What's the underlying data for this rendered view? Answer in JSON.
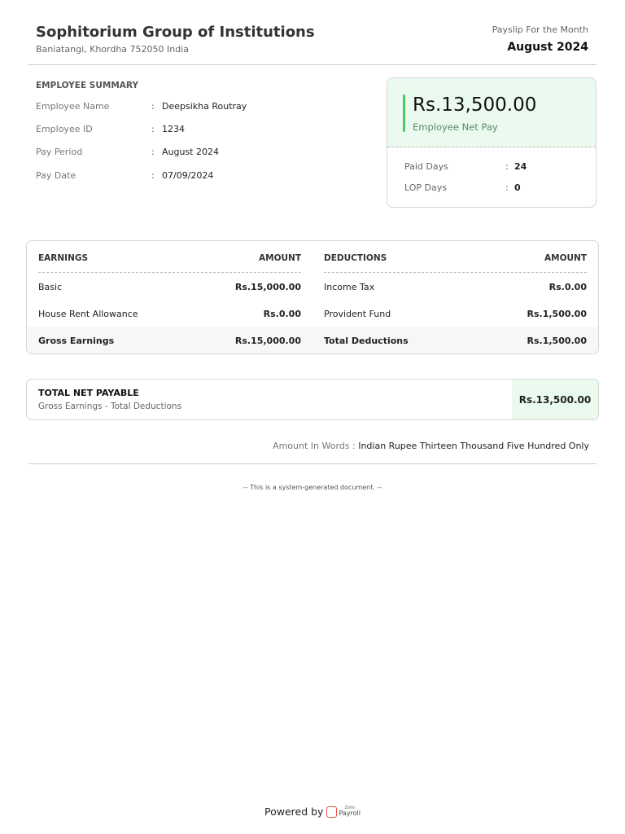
{
  "header": {
    "org_name": "Sophitorium Group of Institutions",
    "address": "Baniatangi, Khordha 752050 India",
    "payslip_label": "Payslip For the Month",
    "month": "August 2024"
  },
  "summary": {
    "title": "EMPLOYEE SUMMARY",
    "rows": [
      {
        "label": "Employee Name",
        "value": "Deepsikha Routray"
      },
      {
        "label": "Employee ID",
        "value": "1234"
      },
      {
        "label": "Pay Period",
        "value": "August 2024"
      },
      {
        "label": "Pay Date",
        "value": "07/09/2024"
      }
    ]
  },
  "net_card": {
    "amount": "Rs.13,500.00",
    "label": "Employee Net Pay",
    "rows": [
      {
        "label": "Paid Days",
        "value": "24"
      },
      {
        "label": "LOP Days",
        "value": "0"
      }
    ]
  },
  "earnings": {
    "header": "EARNINGS",
    "amount_header": "AMOUNT",
    "rows": [
      {
        "label": "Basic",
        "value": "Rs.15,000.00"
      },
      {
        "label": "House Rent Allowance",
        "value": "Rs.0.00"
      }
    ],
    "total_label": "Gross Earnings",
    "total_value": "Rs.15,000.00"
  },
  "deductions": {
    "header": "DEDUCTIONS",
    "amount_header": "AMOUNT",
    "rows": [
      {
        "label": "Income Tax",
        "value": "Rs.0.00"
      },
      {
        "label": "Provident Fund",
        "value": "Rs.1,500.00"
      }
    ],
    "total_label": "Total Deductions",
    "total_value": "Rs.1,500.00"
  },
  "net_payable": {
    "title": "TOTAL NET PAYABLE",
    "subtitle": "Gross Earnings - Total Deductions",
    "amount": "Rs.13,500.00"
  },
  "words": {
    "label": "Amount In Words :",
    "value": "Indian Rupee Thirteen Thousand Five Hundred Only"
  },
  "footer": {
    "note": "-- This is a system-generated document. --",
    "powered_by": "Powered by",
    "logo_brand": "Zoho",
    "logo_product": "Payroll"
  }
}
